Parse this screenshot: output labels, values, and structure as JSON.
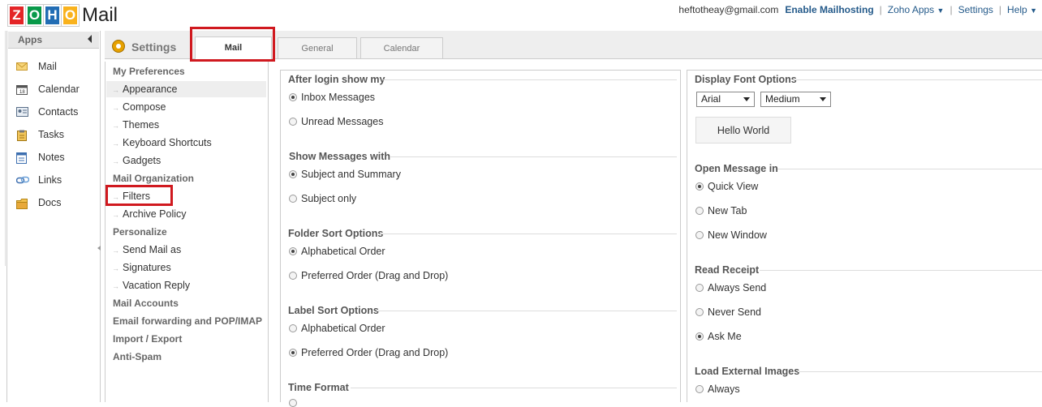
{
  "header": {
    "logo_letters": [
      "Z",
      "O",
      "H",
      "O"
    ],
    "logo_text": "Mail",
    "user_email": "heftotheay@gmail.com",
    "enable_mailhosting": "Enable Mailhosting",
    "zoho_apps": "Zoho Apps",
    "settings": "Settings",
    "help": "Help",
    "separator": "|",
    "colors": {
      "z": "#e42527",
      "o1": "#089949",
      "h": "#226db4",
      "o2": "#f9b21d"
    }
  },
  "apps": {
    "title": "Apps",
    "items": [
      {
        "label": "Mail",
        "icon": "envelope-icon"
      },
      {
        "label": "Calendar",
        "icon": "calendar-icon"
      },
      {
        "label": "Contacts",
        "icon": "contact-card-icon"
      },
      {
        "label": "Tasks",
        "icon": "clipboard-icon"
      },
      {
        "label": "Notes",
        "icon": "notepad-icon"
      },
      {
        "label": "Links",
        "icon": "link-icon"
      },
      {
        "label": "Docs",
        "icon": "folder-icon"
      }
    ]
  },
  "settings": {
    "title": "Settings",
    "tabs": [
      "Mail",
      "General",
      "Calendar"
    ]
  },
  "preferences": {
    "my_preferences": "My Preferences",
    "mp_items": [
      "Appearance",
      "Compose",
      "Themes",
      "Keyboard Shortcuts",
      "Gadgets"
    ],
    "mail_org": "Mail Organization",
    "mo_items": [
      "Filters",
      "Archive Policy"
    ],
    "personalize": "Personalize",
    "p_items": [
      "Send Mail as",
      "Signatures",
      "Vacation Reply"
    ],
    "mail_accounts": "Mail Accounts",
    "email_forwarding": "Email forwarding and POP/IMAP",
    "import_export": "Import / Export",
    "anti_spam": "Anti-Spam"
  },
  "col1": {
    "after_login": {
      "title": "After login show my",
      "options": [
        "Inbox Messages",
        "Unread Messages"
      ],
      "selected": 0
    },
    "show_messages": {
      "title": "Show Messages with",
      "options": [
        "Subject and Summary",
        "Subject only"
      ],
      "selected": 0
    },
    "folder_sort": {
      "title": "Folder Sort Options",
      "options": [
        "Alphabetical Order",
        "Preferred Order (Drag and Drop)"
      ],
      "selected": 0
    },
    "label_sort": {
      "title": "Label Sort Options",
      "options": [
        "Alphabetical Order",
        "Preferred Order (Drag and Drop)"
      ],
      "selected": 1
    },
    "time_format": {
      "title": "Time Format"
    }
  },
  "col2": {
    "display_font": {
      "title": "Display Font Options",
      "font": "Arial",
      "size": "Medium",
      "preview": "Hello World"
    },
    "open_message": {
      "title": "Open Message in",
      "options": [
        "Quick View",
        "New Tab",
        "New Window"
      ],
      "selected": 0
    },
    "read_receipt": {
      "title": "Read Receipt",
      "options": [
        "Always Send",
        "Never Send",
        "Ask Me"
      ],
      "selected": 2
    },
    "load_images": {
      "title": "Load External Images",
      "options": [
        "Always"
      ]
    }
  }
}
